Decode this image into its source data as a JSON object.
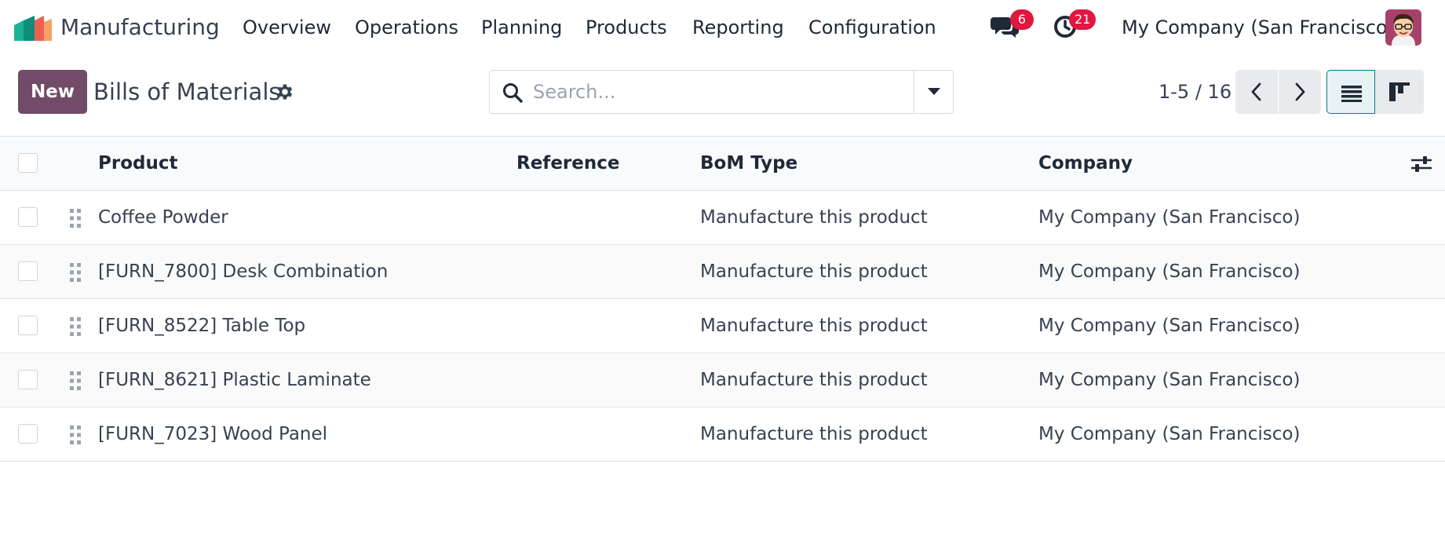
{
  "navbar": {
    "app_name": "Manufacturing",
    "menu": [
      "Overview",
      "Operations",
      "Planning",
      "Products",
      "Reporting",
      "Configuration"
    ],
    "messages_badge": "6",
    "activities_badge": "21",
    "company": "My Company (San Francisco)"
  },
  "control_panel": {
    "new_label": "New",
    "title": "Bills of Materials",
    "search_placeholder": "Search...",
    "pager": "1-5 / 16"
  },
  "table": {
    "columns": [
      "Product",
      "Reference",
      "BoM Type",
      "Company"
    ],
    "rows": [
      {
        "product": "Coffee Powder",
        "reference": "",
        "bom_type": "Manufacture this product",
        "company": "My Company (San Francisco)"
      },
      {
        "product": "[FURN_7800] Desk Combination",
        "reference": "",
        "bom_type": "Manufacture this product",
        "company": "My Company (San Francisco)"
      },
      {
        "product": "[FURN_8522] Table Top",
        "reference": "",
        "bom_type": "Manufacture this product",
        "company": "My Company (San Francisco)"
      },
      {
        "product": "[FURN_8621] Plastic Laminate",
        "reference": "",
        "bom_type": "Manufacture this product",
        "company": "My Company (San Francisco)"
      },
      {
        "product": "[FURN_7023] Wood Panel",
        "reference": "",
        "bom_type": "Manufacture this product",
        "company": "My Company (San Francisco)"
      }
    ]
  },
  "colors": {
    "primary": "#714b67",
    "badge": "#e0173e",
    "active_view": "#017e84"
  },
  "icons": {
    "logo": "manufacturing-logo-icon",
    "messages": "chat-bubbles-icon",
    "activities": "clock-icon",
    "settings": "gear-icon",
    "search": "search-icon",
    "dropdown": "caret-down-icon",
    "prev": "chevron-left-icon",
    "next": "chevron-right-icon",
    "list_view": "list-view-icon",
    "kanban_view": "kanban-view-icon",
    "column_settings": "sliders-icon",
    "drag": "drag-handle-icon"
  }
}
